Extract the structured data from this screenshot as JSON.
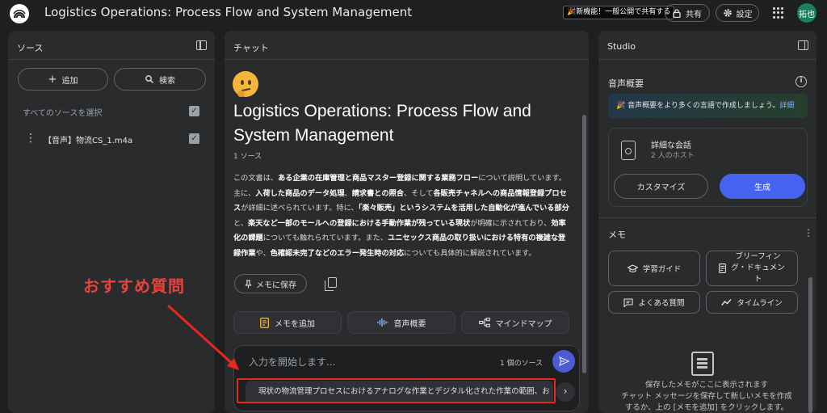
{
  "header": {
    "app_title": "Logistics Operations: Process Flow and System Management",
    "new_feature": "🎉新機能！一般公開で共有する",
    "share_label": "共有",
    "settings_label": "設定",
    "avatar_text": "拓也"
  },
  "sources": {
    "title": "ソース",
    "add_label": "追加",
    "search_label": "検索",
    "select_all": "すべてのソースを選択",
    "items": [
      {
        "label": "【音声】物流CS_1.m4a",
        "checked": true
      }
    ]
  },
  "chat": {
    "title": "チャット",
    "notebook_title": "Logistics Operations: Process Flow and System Management",
    "source_count": "1 ソース",
    "summary_parts": [
      {
        "text": "この文書は、",
        "bold": false
      },
      {
        "text": "ある企業の在庫管理と商品マスター登録に関する業務フロー",
        "bold": true
      },
      {
        "text": "について説明しています。主に、",
        "bold": false
      },
      {
        "text": "入荷した商品のデータ処理",
        "bold": true
      },
      {
        "text": "、",
        "bold": false
      },
      {
        "text": "請求書との照合",
        "bold": true
      },
      {
        "text": "、そして",
        "bold": false
      },
      {
        "text": "各販売チャネルへの商品情報登録プロセス",
        "bold": true
      },
      {
        "text": "が詳細に述べられています。特に、",
        "bold": false
      },
      {
        "text": "「楽々販売」というシステムを活用した自動化が進んでいる部分",
        "bold": true
      },
      {
        "text": "と、",
        "bold": false
      },
      {
        "text": "楽天など一部のモールへの登録における手動作業が残っている現状",
        "bold": true
      },
      {
        "text": "が明確に示されており、",
        "bold": false
      },
      {
        "text": "効率化の課題",
        "bold": true
      },
      {
        "text": "についても触れられています。また、",
        "bold": false
      },
      {
        "text": "ユニセックス商品の取り扱いにおける特有の複雑な登録作業",
        "bold": true
      },
      {
        "text": "や、",
        "bold": false
      },
      {
        "text": "色確認未完了などのエラー発生時の対応",
        "bold": true
      },
      {
        "text": "についても具体的に解説されています。",
        "bold": false
      }
    ],
    "save_memo_label": "メモに保存",
    "actions": {
      "add_memo": "メモを追加",
      "audio_overview": "音声概要",
      "mind_map": "マインドマップ"
    },
    "input": {
      "placeholder": "入力を開始します...",
      "source_count": "1 個のソース"
    },
    "suggestion": "現状の物流管理プロセスにおけるアナログな作業とデジタル化された作業の範囲、お"
  },
  "studio": {
    "title": "Studio",
    "audio_section_title": "音声概要",
    "promo_text": "🎉 音声概要をより多くの言語で作成しましょう。",
    "promo_link": "詳細",
    "audio_card_title": "詳細な会話",
    "audio_card_sub": "2 人のホスト",
    "customize_label": "カスタマイズ",
    "generate_label": "生成",
    "memo_section_title": "メモ",
    "memo_buttons": {
      "study_guide": "学習ガイド",
      "briefing_line1": "ブリーフィン",
      "briefing_line2": "グ・ドキュメン",
      "briefing_line3": "ト",
      "faq": "よくある質問",
      "timeline": "タイムライン"
    },
    "empty_line1": "保存したメモがここに表示されます",
    "empty_line2": "チャット メッセージを保存して新しいメモを作成",
    "empty_line3": "するか、上の [メモを追加] をクリックします。"
  },
  "annotation": {
    "label": "おすすめ質問",
    "color": "#e8433a"
  },
  "colors": {
    "accent_blue": "#4663f0",
    "send_button": "#4c5bd4",
    "background": "#1e1f20",
    "panel": "#2a2b2d"
  }
}
